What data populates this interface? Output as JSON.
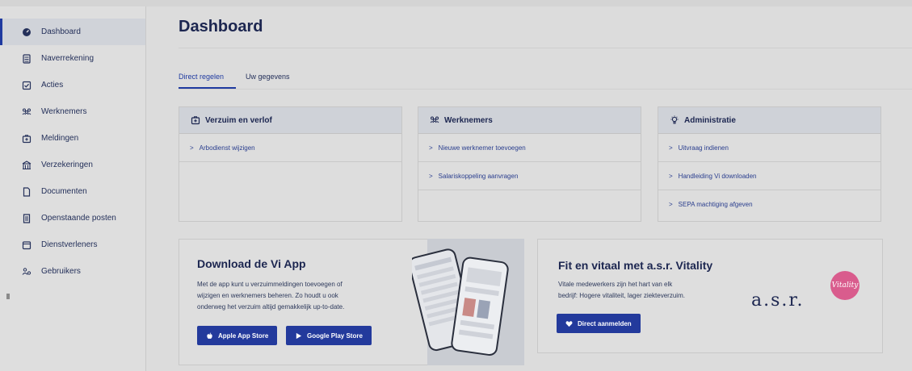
{
  "sidebar": {
    "items": [
      {
        "label": "Dashboard",
        "icon": "dashboard-gauge-icon"
      },
      {
        "label": "Naverrekening",
        "icon": "calculator-icon"
      },
      {
        "label": "Acties",
        "icon": "checkbox-icon"
      },
      {
        "label": "Werknemers",
        "icon": "people-group-icon"
      },
      {
        "label": "Meldingen",
        "icon": "medical-case-icon"
      },
      {
        "label": "Verzekeringen",
        "icon": "building-icon"
      },
      {
        "label": "Documenten",
        "icon": "document-icon"
      },
      {
        "label": "Openstaande posten",
        "icon": "invoice-icon"
      },
      {
        "label": "Dienstverleners",
        "icon": "calendar-card-icon"
      },
      {
        "label": "Gebruikers",
        "icon": "users-settings-icon"
      }
    ]
  },
  "page": {
    "title": "Dashboard"
  },
  "tabs": [
    {
      "label": "Direct regelen",
      "active": true
    },
    {
      "label": "Uw gegevens",
      "active": false
    }
  ],
  "cards": [
    {
      "title": "Verzuim en verlof",
      "icon": "medical-case-icon",
      "links": [
        "Arbodienst wijzigen"
      ]
    },
    {
      "title": "Werknemers",
      "icon": "people-group-icon",
      "links": [
        "Nieuwe werknemer toevoegen",
        "Salariskoppeling aanvragen"
      ]
    },
    {
      "title": "Administratie",
      "icon": "lightbulb-icon",
      "links": [
        "Uitvraag indienen",
        "Handleiding Vi downloaden",
        "SEPA machtiging afgeven"
      ]
    }
  ],
  "app_promo": {
    "title": "Download de Vi App",
    "text": [
      "Met de app kunt u verzuimmeldingen toevoegen of",
      "wijzigen en werknemers beheren. Zo houdt u ook",
      "onderweg het verzuim altijd gemakkelijk up-to-date."
    ],
    "apple_button": "Apple App Store",
    "google_button": "Google Play Store"
  },
  "vitality_promo": {
    "title": "Fit en vitaal met a.s.r. Vitality",
    "text": [
      "Vitale medewerkers zijn het hart van elk",
      "bedrijf: Hogere vitaliteit, lager ziekteverzuim."
    ],
    "button": "Direct aanmelden",
    "logo_text": "a.s.r.",
    "badge_text": "Vitality"
  },
  "colors": {
    "accent": "#1f3aa0",
    "button": "#233a9c",
    "vitality_pink": "#d95c8d"
  }
}
